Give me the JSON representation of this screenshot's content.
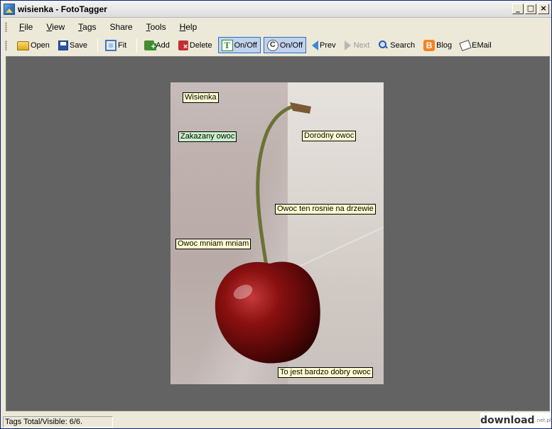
{
  "window": {
    "title": "wisienka - FotoTagger"
  },
  "window_controls": {
    "minimize": "_",
    "maximize": "□",
    "close": "×"
  },
  "menu": [
    {
      "label": "File",
      "accel": "F",
      "rest": "ile"
    },
    {
      "label": "View",
      "accel": "V",
      "rest": "iew"
    },
    {
      "label": "Tags",
      "accel": "T",
      "rest": "ags"
    },
    {
      "label": "Share",
      "accel": "",
      "rest": "Share"
    },
    {
      "label": "Tools",
      "accel": "T",
      "rest": "ools"
    },
    {
      "label": "Help",
      "accel": "H",
      "rest": "elp"
    }
  ],
  "toolbar": {
    "open": "Open",
    "save": "Save",
    "fit": "Fit",
    "add": "Add",
    "delete": "Delete",
    "tags_toggle": "On/Off",
    "comments_toggle": "On/Off",
    "prev": "Prev",
    "next": "Next",
    "search": "Search",
    "blog": "Blog",
    "email": "EMail"
  },
  "photo_tags": [
    {
      "text": "Wisienka",
      "style": "yellow"
    },
    {
      "text": "Zakazany owoc",
      "style": "green"
    },
    {
      "text": "Dorodny owoc",
      "style": "yellow"
    },
    {
      "text": "Owoc ten rosnie na drzewie",
      "style": "yellow"
    },
    {
      "text": "Owoc mniam mniam",
      "style": "yellow"
    },
    {
      "text": "To jest bardzo dobry owoc",
      "style": "yellow"
    }
  ],
  "status": {
    "text": "Tags Total/Visible: 6/6."
  },
  "watermark": {
    "text": "download",
    "suffix": ".net.pl"
  },
  "colors": {
    "canvas_bg": "#636363",
    "chrome_bg": "#ece9d8",
    "tag_yellow": "#ffffd0",
    "tag_green": "#c8f0c8",
    "cherry": "#8a1010"
  }
}
